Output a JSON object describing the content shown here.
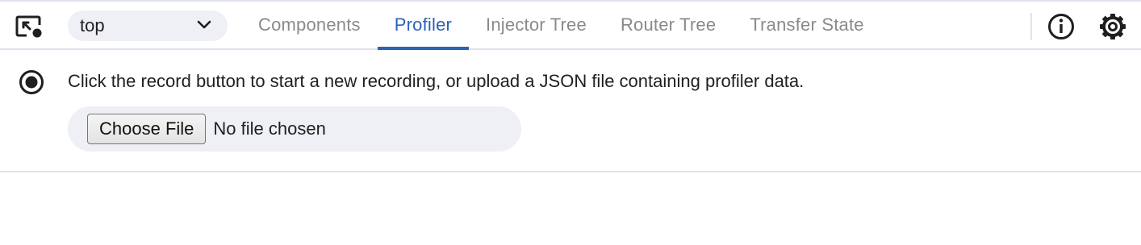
{
  "toolbar": {
    "inspect_icon": "inspect-element-icon",
    "frame_select": {
      "value": "top",
      "icon": "chevron-down-icon"
    },
    "tabs": [
      {
        "label": "Components",
        "active": false
      },
      {
        "label": "Profiler",
        "active": true
      },
      {
        "label": "Injector Tree",
        "active": false
      },
      {
        "label": "Router Tree",
        "active": false
      },
      {
        "label": "Transfer State",
        "active": false
      }
    ],
    "info_icon": "info-icon",
    "settings_icon": "gear-icon"
  },
  "profiler": {
    "record_icon": "record-icon",
    "message": "Click the record button to start a new recording, or upload a JSON file containing profiler data.",
    "upload": {
      "button_label": "Choose File",
      "status": "No file chosen"
    }
  },
  "colors": {
    "accent": "#2a62b8",
    "tab_inactive": "#8a8a8a",
    "pill_bg": "#eef0f6",
    "divider": "#dfe3ee",
    "text": "#1f1f1f"
  }
}
